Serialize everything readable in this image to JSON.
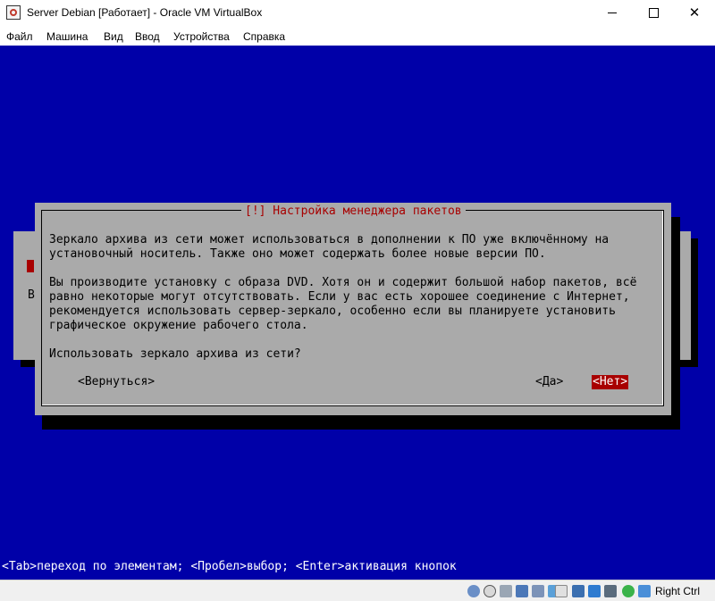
{
  "window": {
    "title": "Server Debian [Работает] - Oracle VM VirtualBox",
    "minimize_symbol": "",
    "close_symbol": "✕"
  },
  "menubar": {
    "items": [
      "Файл",
      "Машина",
      "Вид",
      "Ввод",
      "Устройства",
      "Справка"
    ]
  },
  "installer": {
    "background_letter": "В",
    "dialog_title": "[!] Настройка менеджера пакетов",
    "paragraph1": "Зеркало архива из сети может использоваться в дополнении к ПО уже включённому на\nустановочный носитель. Также оно может содержать более новые версии ПО.",
    "paragraph2": "Вы производите установку с образа DVD. Хотя он и содержит большой набор пакетов, всё\nравно некоторые могут отсутствовать. Если у вас есть хорошее соединение с Интернет,\nрекомендуется использовать сервер-зеркало, особенно если вы планируете установить\nграфическое окружение рабочего стола.",
    "question": "Использовать зеркало архива из сети?",
    "buttons": {
      "back": "<Вернуться>",
      "yes": "<Да>",
      "no": "<Нет>"
    },
    "hint": "<Tab>переход по элементам; <Пробел>выбор; <Enter>активация кнопок"
  },
  "statusbar": {
    "host_key": "Right Ctrl",
    "icons": [
      "hard-disk-icon",
      "optical-drive-icon",
      "audio-icon",
      "network-icon",
      "usb-icon",
      "shared-folders-icon",
      "display-icon",
      "video-capture-icon",
      "cpu-icon",
      "virtualization-icon",
      "mouse-integration-icon",
      "keyboard-icon"
    ]
  },
  "colors": {
    "screen_bg": "#0000a8",
    "dialog_bg": "#aaaaaa",
    "accent_red": "#a80000"
  }
}
